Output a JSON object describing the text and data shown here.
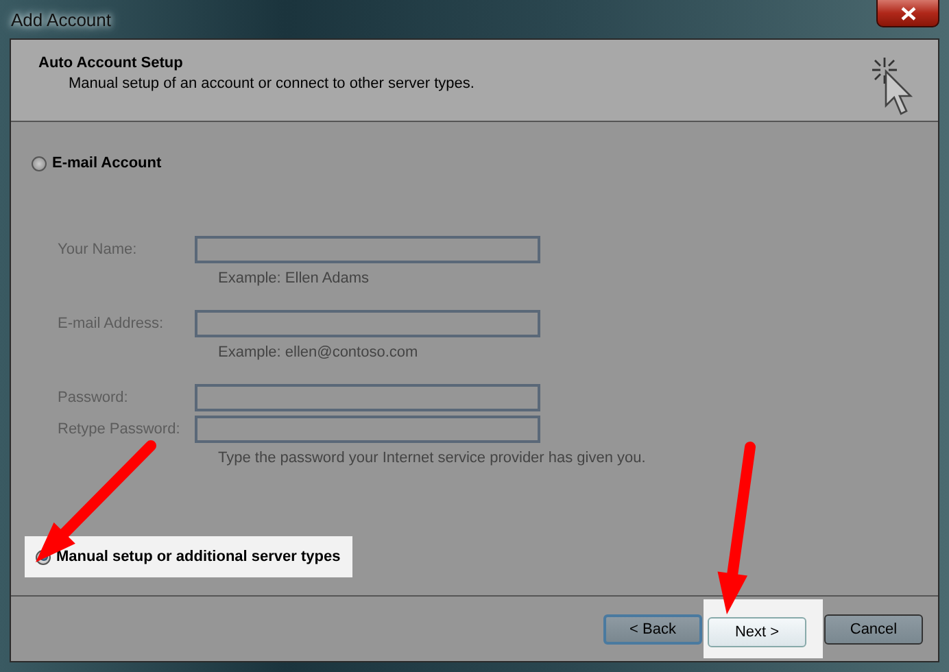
{
  "window": {
    "title": "Add Account"
  },
  "header": {
    "title": "Auto Account Setup",
    "subtitle": "Manual setup of an account or connect to other server types."
  },
  "email_option": {
    "label": "E-mail Account",
    "selected": false
  },
  "fields": [
    {
      "label": "Your Name:",
      "hint": "Example: Ellen Adams",
      "disabled": true
    },
    {
      "label": "E-mail Address:",
      "hint": "Example: ellen@contoso.com",
      "disabled": true
    },
    {
      "label": "Password:",
      "disabled": true
    },
    {
      "label": "Retype Password:",
      "hint": "Type the password your Internet service provider has given you.",
      "disabled": true
    }
  ],
  "manual_option": {
    "label": "Manual setup or additional server types",
    "selected": true,
    "highlighted": true
  },
  "buttons": [
    {
      "label": "< Back",
      "highlighted": false
    },
    {
      "label": "Next >",
      "highlighted": true
    },
    {
      "label": "Cancel",
      "highlighted": false
    }
  ]
}
